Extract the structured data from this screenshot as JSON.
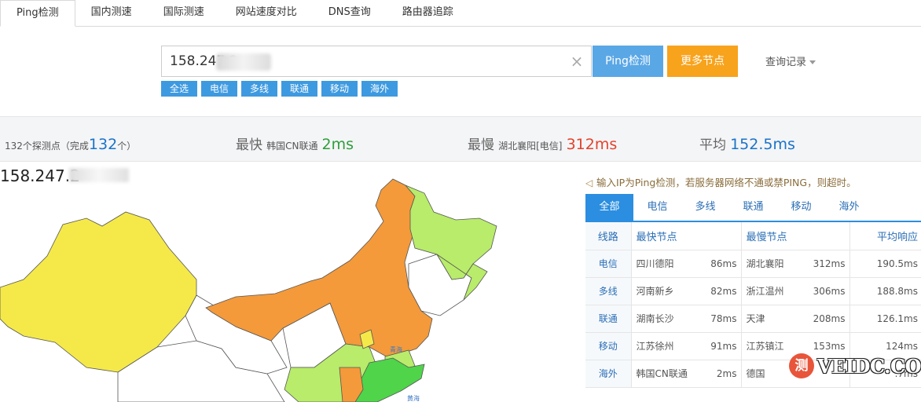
{
  "tabs": [
    {
      "label": "Ping检测",
      "active": true
    },
    {
      "label": "国内测速",
      "active": false
    },
    {
      "label": "国际测速",
      "active": false
    },
    {
      "label": "网站速度对比",
      "active": false
    },
    {
      "label": "DNS查询",
      "active": false
    },
    {
      "label": "路由器追踪",
      "active": false
    }
  ],
  "search": {
    "value": "158.247.2",
    "clear_icon": "×",
    "ping_button": "Ping检测",
    "more_button": "更多节点",
    "history_label": "查询记录"
  },
  "chips": [
    "全选",
    "电信",
    "多线",
    "联通",
    "移动",
    "海外"
  ],
  "stats": {
    "nodes_prefix": "132个探测点（完成",
    "nodes_done": "132",
    "nodes_suffix": "个）",
    "fastest_label": "最快",
    "fastest_node": "韩国CN联通",
    "fastest_value": "2ms",
    "slowest_label": "最慢",
    "slowest_node": "湖北襄阳[电信]",
    "slowest_value": "312ms",
    "avg_label": "平均",
    "avg_value": "152.5ms"
  },
  "map": {
    "ip_label": "158.247.2",
    "labels": [
      "青海",
      "黄海"
    ]
  },
  "notice": {
    "icon": "speaker-icon",
    "text": "输入IP为Ping检测，若服务器网络不通或禁PING，则超时。"
  },
  "result_tabs": [
    {
      "label": "全部",
      "active": true
    },
    {
      "label": "电信",
      "active": false
    },
    {
      "label": "多线",
      "active": false
    },
    {
      "label": "联通",
      "active": false
    },
    {
      "label": "移动",
      "active": false
    },
    {
      "label": "海外",
      "active": false
    }
  ],
  "table": {
    "headers": [
      "线路",
      "最快节点",
      "最慢节点",
      "平均响应"
    ],
    "rows": [
      {
        "line": "电信",
        "fast": "四川德阳",
        "fast_ms": "86ms",
        "slow": "湖北襄阳",
        "slow_ms": "312ms",
        "avg": "190.5ms"
      },
      {
        "line": "多线",
        "fast": "河南新乡",
        "fast_ms": "82ms",
        "slow": "浙江温州",
        "slow_ms": "306ms",
        "avg": "188.8ms"
      },
      {
        "line": "联通",
        "fast": "湖南长沙",
        "fast_ms": "78ms",
        "slow": "天津",
        "slow_ms": "208ms",
        "avg": "126.1ms"
      },
      {
        "line": "移动",
        "fast": "江苏徐州",
        "fast_ms": "91ms",
        "slow": "江苏镇江",
        "slow_ms": "153ms",
        "avg": "124ms"
      },
      {
        "line": "海外",
        "fast": "韩国CN联通",
        "fast_ms": "2ms",
        "slow": "德国",
        "slow_ms": "",
        "avg": ".7ms"
      }
    ]
  },
  "watermark": {
    "badge": "测",
    "text": "VEIDC.COM"
  },
  "colors": {
    "accent_blue": "#2b8ee0",
    "chip_blue": "#3e9ae0",
    "ping_button": "#5aa7e6",
    "more_button": "#f8a31c",
    "fast_green": "#2e9e3a",
    "slow_red": "#e2432b",
    "map_yellow": "#f5e94a",
    "map_orange": "#f49a3a",
    "map_lightgreen": "#b8ec6a",
    "map_green": "#4fd44a"
  }
}
